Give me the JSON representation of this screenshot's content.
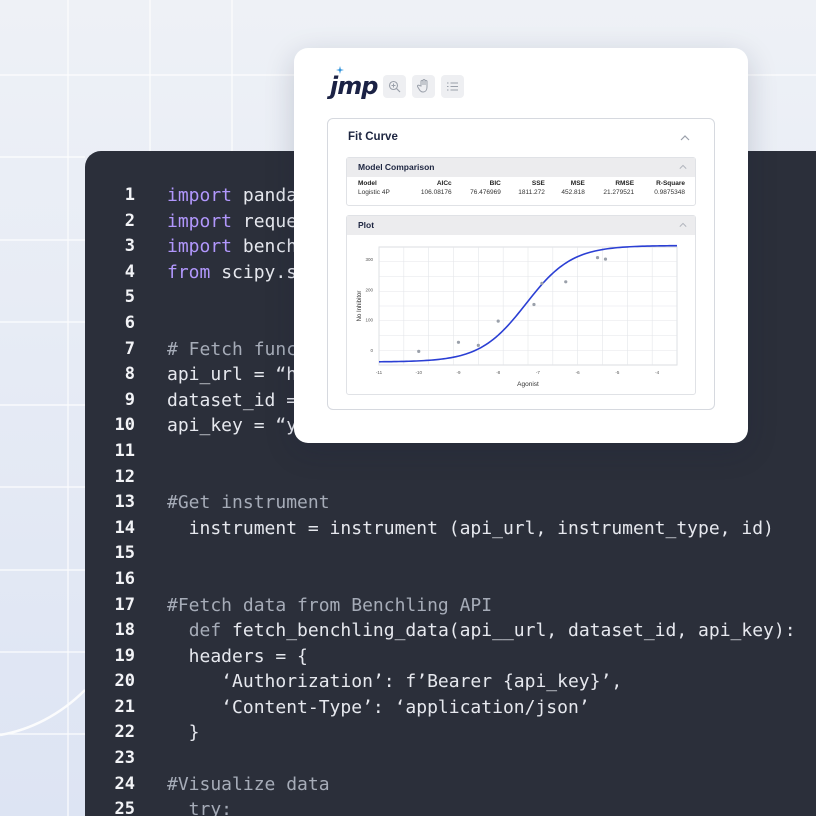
{
  "code": {
    "lines": [
      {
        "n": "1",
        "parts": [
          {
            "t": "import",
            "c": "kw"
          },
          {
            "t": " panda",
            "c": "pl"
          }
        ]
      },
      {
        "n": "2",
        "parts": [
          {
            "t": "import",
            "c": "kw"
          },
          {
            "t": " reque",
            "c": "pl"
          }
        ]
      },
      {
        "n": "3",
        "parts": [
          {
            "t": "import",
            "c": "kw"
          },
          {
            "t": " bench",
            "c": "pl"
          }
        ]
      },
      {
        "n": "4",
        "parts": [
          {
            "t": "from",
            "c": "kw"
          },
          {
            "t": " scipy.s",
            "c": "pl"
          }
        ]
      },
      {
        "n": "5",
        "parts": []
      },
      {
        "n": "6",
        "parts": []
      },
      {
        "n": "7",
        "parts": [
          {
            "t": "# Fetch func",
            "c": "cm"
          }
        ]
      },
      {
        "n": "8",
        "parts": [
          {
            "t": "api_url = “h",
            "c": "pl"
          }
        ]
      },
      {
        "n": "9",
        "parts": [
          {
            "t": "dataset_id =",
            "c": "pl"
          }
        ]
      },
      {
        "n": "10",
        "parts": [
          {
            "t": "api_key = “y",
            "c": "pl"
          }
        ]
      },
      {
        "n": "11",
        "parts": []
      },
      {
        "n": "12",
        "parts": []
      },
      {
        "n": "13",
        "parts": [
          {
            "t": "#Get instrument",
            "c": "cm"
          }
        ]
      },
      {
        "n": "14",
        "parts": [
          {
            "t": "  instrument = instrument (api_url, instrument_type, id)",
            "c": "pl"
          }
        ]
      },
      {
        "n": "15",
        "parts": []
      },
      {
        "n": "16",
        "parts": []
      },
      {
        "n": "17",
        "parts": [
          {
            "t": "#Fetch data from Benchling API",
            "c": "cm"
          }
        ]
      },
      {
        "n": "18",
        "parts": [
          {
            "t": "  ",
            "c": "pl"
          },
          {
            "t": "def",
            "c": "cm"
          },
          {
            "t": " fetch_benchling_data(api__url, dataset_id, api_key):",
            "c": "pl"
          }
        ]
      },
      {
        "n": "19",
        "parts": [
          {
            "t": "  headers = {",
            "c": "pl"
          }
        ]
      },
      {
        "n": "20",
        "parts": [
          {
            "t": "     ‘Authorization’: f’Bearer {api_key}’,",
            "c": "pl"
          }
        ]
      },
      {
        "n": "21",
        "parts": [
          {
            "t": "     ‘Content-Type’: ‘application/json’",
            "c": "pl"
          }
        ]
      },
      {
        "n": "22",
        "parts": [
          {
            "t": "  }",
            "c": "pl"
          }
        ]
      },
      {
        "n": "23",
        "parts": []
      },
      {
        "n": "24",
        "parts": [
          {
            "t": "#Visualize data",
            "c": "cm"
          }
        ]
      },
      {
        "n": "25",
        "parts": [
          {
            "t": "  try:",
            "c": "cm"
          }
        ]
      }
    ]
  },
  "jmp": {
    "logo": "jmp",
    "tools": [
      "zoom-icon",
      "hand-icon",
      "list-icon"
    ],
    "fit_title": "Fit Curve",
    "model_comparison": {
      "title": "Model Comparison",
      "headers": [
        "Model",
        "AICc",
        "BIC",
        "SSE",
        "MSE",
        "RMSE",
        "R-Square"
      ],
      "rows": [
        [
          "Logistic 4P",
          "106.08176",
          "76.476969",
          "1811.272",
          "452.818",
          "21.279521",
          "0.9875348"
        ]
      ]
    },
    "plot_title": "Plot"
  },
  "chart_data": {
    "type": "scatter",
    "title": "",
    "xlabel": "Agonist",
    "ylabel": "No Inhibitor",
    "x_ticks": [
      "-11",
      "-10",
      "-9",
      "-8",
      "-7",
      "-6",
      "-5",
      "-4"
    ],
    "y_ticks": [
      "0",
      "100",
      "200",
      "300"
    ],
    "xlim": [
      -11,
      -3.5
    ],
    "ylim": [
      -50,
      340
    ],
    "points": [
      {
        "x": -10.0,
        "y": -5
      },
      {
        "x": -9.0,
        "y": 25
      },
      {
        "x": -8.5,
        "y": 15
      },
      {
        "x": -8.0,
        "y": 95
      },
      {
        "x": -7.1,
        "y": 150
      },
      {
        "x": -6.9,
        "y": 220
      },
      {
        "x": -6.3,
        "y": 225
      },
      {
        "x": -5.5,
        "y": 305
      },
      {
        "x": -5.3,
        "y": 300
      }
    ],
    "series": [
      {
        "type": "logistic4p",
        "bottom": -40,
        "top": 345,
        "ec50": -7.3,
        "hill": 0.75
      }
    ],
    "colors": {
      "curve": "#2b3fd4",
      "points": "#9aa0aa"
    },
    "grid": true
  }
}
